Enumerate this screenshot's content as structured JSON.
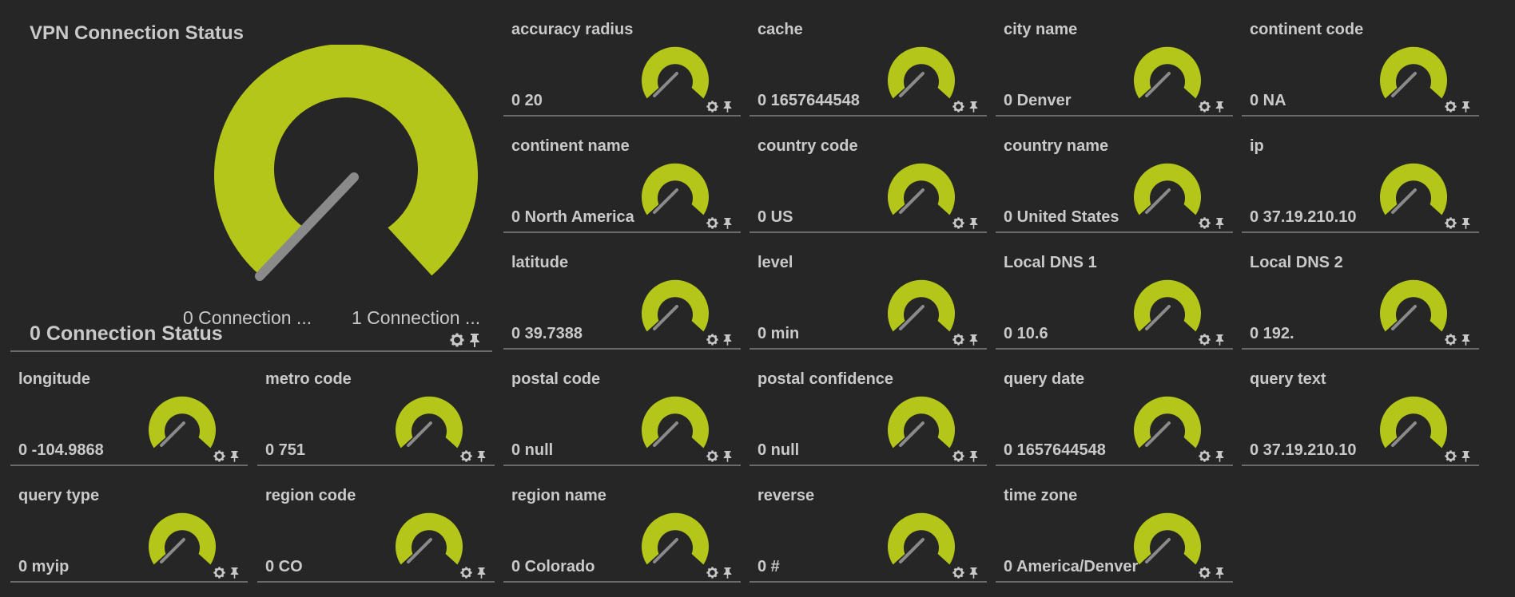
{
  "colors": {
    "background": "#262626",
    "gauge": "#b5c61a",
    "needle": "#8a8a8a",
    "divider": "#6a6a6a",
    "text": "#c9c9c9"
  },
  "main_gauge": {
    "title": "VPN Connection Status",
    "value": "0 Connection Status",
    "min_label": "0 Connection ...",
    "max_label": "1 Connection ..."
  },
  "tiles": [
    {
      "title": "accuracy radius",
      "value": "0 20"
    },
    {
      "title": "cache",
      "value": "0 1657644548"
    },
    {
      "title": "city name",
      "value": "0 Denver"
    },
    {
      "title": "continent code",
      "value": "0 NA"
    },
    {
      "title": "continent name",
      "value": "0 North America"
    },
    {
      "title": "country code",
      "value": "0 US"
    },
    {
      "title": "country name",
      "value": "0 United States"
    },
    {
      "title": "ip",
      "value": "0 37.19.210.10"
    },
    {
      "title": "latitude",
      "value": "0 39.7388"
    },
    {
      "title": "level",
      "value": "0 min"
    },
    {
      "title": "Local DNS 1",
      "value": "0 10.6"
    },
    {
      "title": "Local DNS 2",
      "value": "0 192."
    },
    {
      "title": "longitude",
      "value": "0 -104.9868"
    },
    {
      "title": "metro code",
      "value": "0 751"
    },
    {
      "title": "postal code",
      "value": "0 null"
    },
    {
      "title": "postal confidence",
      "value": "0 null"
    },
    {
      "title": "query date",
      "value": "0 1657644548"
    },
    {
      "title": "query text",
      "value": "0 37.19.210.10"
    },
    {
      "title": "query type",
      "value": "0 myip"
    },
    {
      "title": "region code",
      "value": "0 CO"
    },
    {
      "title": "region name",
      "value": "0 Colorado"
    },
    {
      "title": "reverse",
      "value": "0 #"
    },
    {
      "title": "time zone",
      "value": "0 America/Denver"
    }
  ],
  "icons": {
    "settings": "gear-icon",
    "pin": "pin-icon"
  }
}
